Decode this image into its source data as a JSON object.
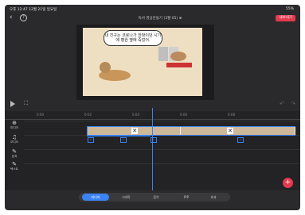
{
  "status": {
    "time": "오후 12:47 12월 21일 일요일",
    "system": "55%"
  },
  "header": {
    "title": "독서 영상만들기 (3월 05) ⊕",
    "export_label": "내보내기"
  },
  "preview": {
    "bubble_text": "내 친구는 코로나가 한창이던 시기에 병원 옆에 죽었어."
  },
  "timeline": {
    "ruler": [
      "0:00",
      "0:02",
      "0:04",
      "0:06",
      "0:08"
    ],
    "sidebar": [
      {
        "icon": "⊕",
        "label": "미디어"
      },
      {
        "icon": "♫",
        "label": "오디오"
      },
      {
        "icon": "✎",
        "label": "효과"
      },
      {
        "icon": "✎",
        "label": "텍스트"
      }
    ]
  },
  "bottom_tabs": [
    "미디어",
    "그래픽",
    "음악",
    "PIP",
    "효과"
  ],
  "colors": {
    "accent": "#3b82f6",
    "brand": "#e3394f"
  }
}
